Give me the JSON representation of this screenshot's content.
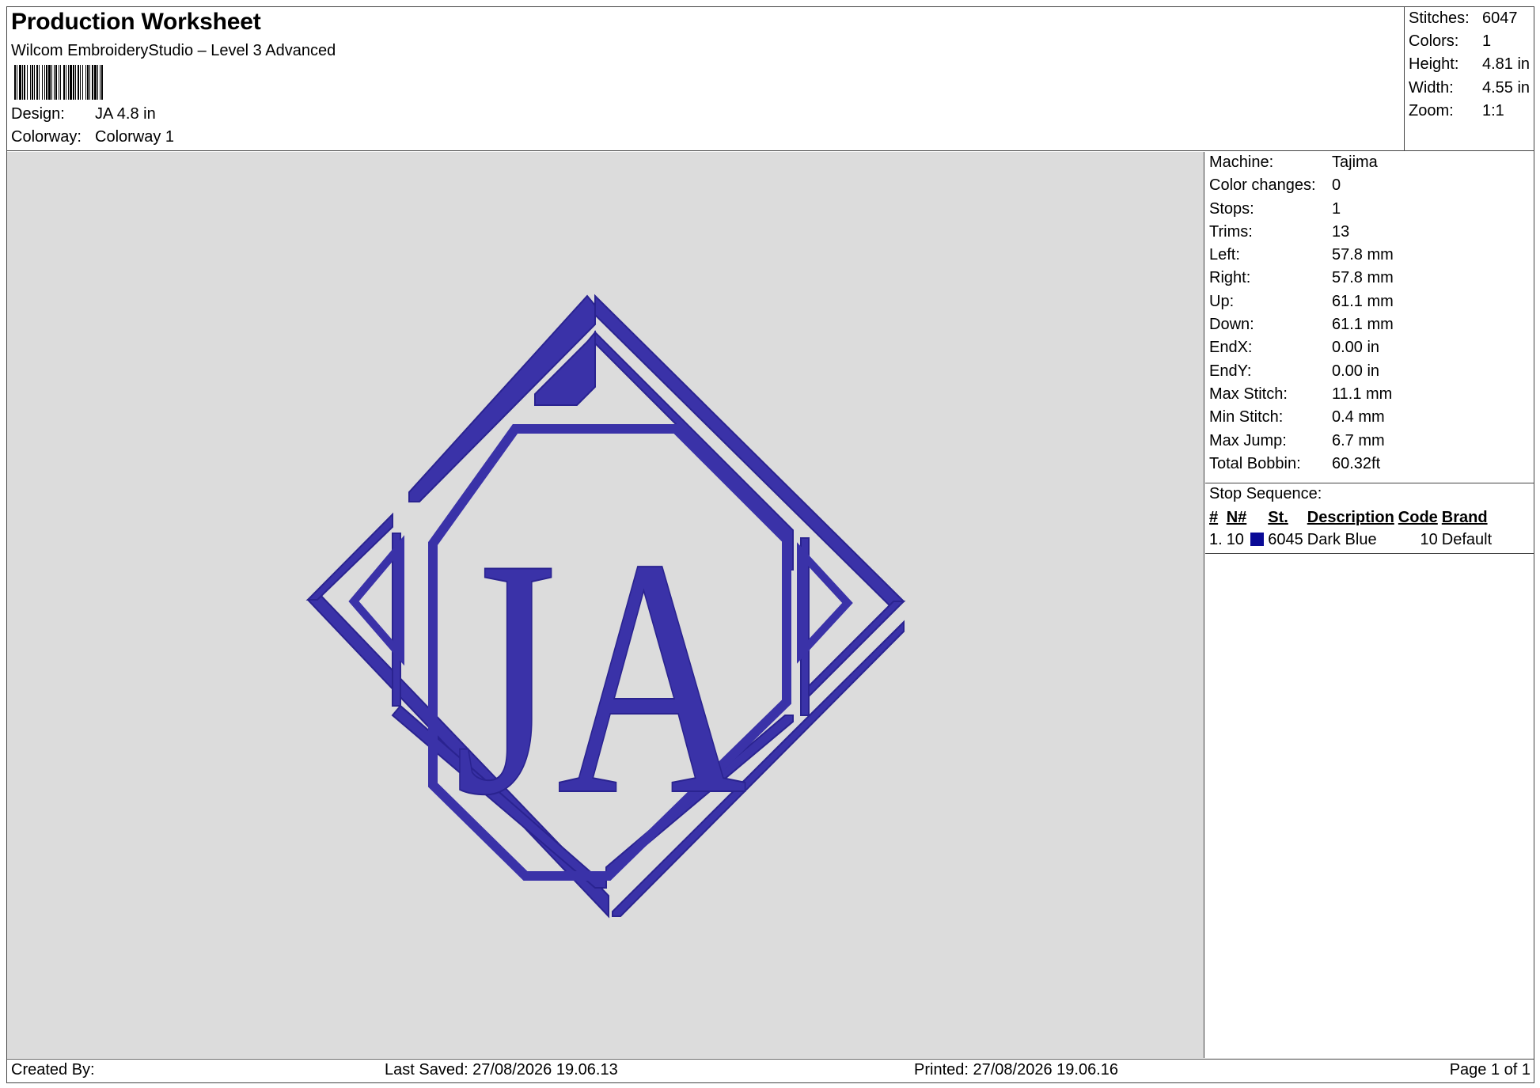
{
  "header": {
    "title": "Production Worksheet",
    "software": "Wilcom EmbroideryStudio – Level 3 Advanced",
    "design_label": "Design:",
    "design_value": "JA 4.8 in",
    "colorway_label": "Colorway:",
    "colorway_value": "Colorway 1"
  },
  "stats": [
    {
      "label": "Stitches:",
      "value": "6047"
    },
    {
      "label": "Colors:",
      "value": "1"
    },
    {
      "label": "Height:",
      "value": "4.81 in"
    },
    {
      "label": "Width:",
      "value": "4.55 in"
    },
    {
      "label": "Zoom:",
      "value": "1:1"
    }
  ],
  "design_preview": {
    "thread_color": "#3a32a8",
    "thread_shade": "#2a2390",
    "background_color": "#dcdcdc",
    "letters": "JA"
  },
  "info": [
    {
      "label": "Machine:",
      "value": "Tajima"
    },
    {
      "label": "Color changes:",
      "value": "0"
    },
    {
      "label": "Stops:",
      "value": "1"
    },
    {
      "label": "Trims:",
      "value": "13"
    },
    {
      "label": "Left:",
      "value": "57.8 mm"
    },
    {
      "label": "Right:",
      "value": "57.8 mm"
    },
    {
      "label": "Up:",
      "value": "61.1 mm"
    },
    {
      "label": "Down:",
      "value": "61.1 mm"
    },
    {
      "label": "EndX:",
      "value": "0.00 in"
    },
    {
      "label": "EndY:",
      "value": "0.00 in"
    },
    {
      "label": "Max Stitch:",
      "value": "11.1 mm"
    },
    {
      "label": "Min Stitch:",
      "value": "0.4 mm"
    },
    {
      "label": "Max Jump:",
      "value": "6.7 mm"
    },
    {
      "label": "Total Bobbin:",
      "value": "60.32ft"
    }
  ],
  "stop_sequence": {
    "title": "Stop Sequence:",
    "columns": [
      "#",
      "N#",
      "St.",
      "Description",
      "Code",
      "Brand"
    ],
    "rows": [
      {
        "num": "1.",
        "needle": "10",
        "color": "#0a0a96",
        "stitches": "6045",
        "description": "Dark Blue",
        "code": "10",
        "brand": "Default"
      }
    ]
  },
  "footer": {
    "created_by": "Created By:",
    "last_saved": "Last Saved: 27/08/2026 19.06.13",
    "printed": "Printed: 27/08/2026 19.06.16",
    "page": "Page 1 of 1"
  }
}
